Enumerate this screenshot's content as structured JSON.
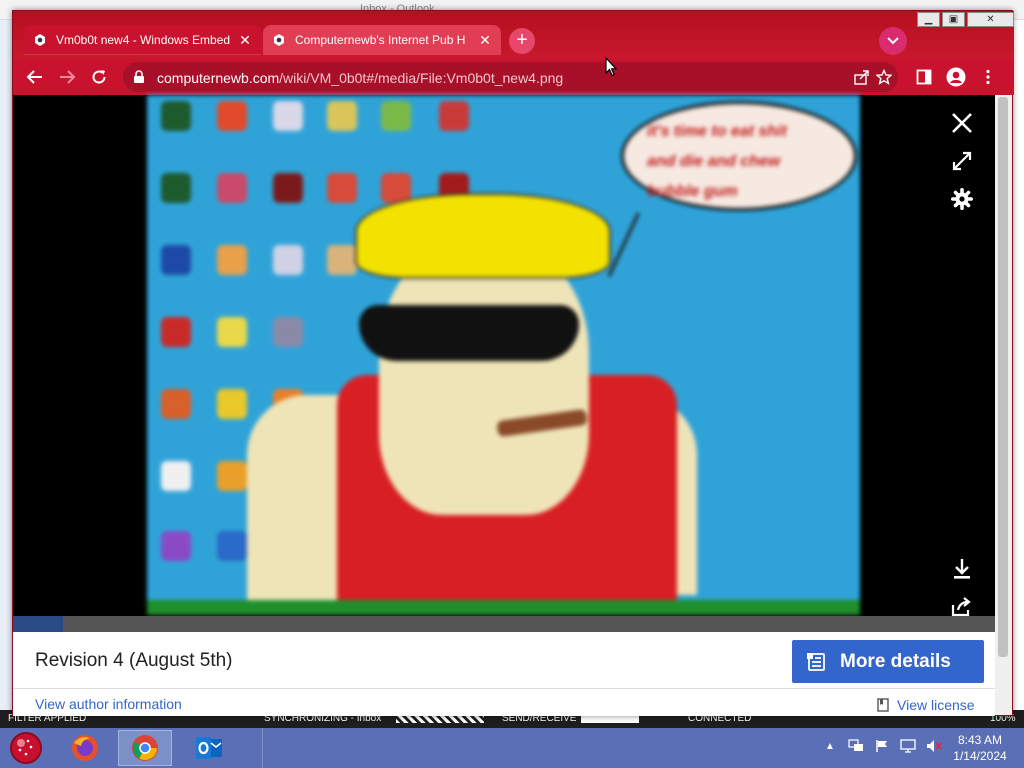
{
  "background_app": {
    "title": "Inbox - Outlook",
    "status": {
      "filter": "FILTER APPLIED",
      "sync": "SYNCHRONIZING - Inbox",
      "send_receive": "SEND/RECEIVE",
      "connection": "CONNECTED",
      "zoom": "100%"
    }
  },
  "browser": {
    "tabs": [
      {
        "title": "Vm0b0t new4 - Windows Embed",
        "active": true,
        "favicon": "wiki-favicon-icon"
      },
      {
        "title": "Computernewb's Internet Pub H",
        "active": false,
        "favicon": "wiki-favicon-icon"
      }
    ],
    "url": {
      "domain": "computernewb.com",
      "path": "/wiki/VM_0b0t#/media/File:Vm0b0t_new4.png"
    },
    "colors": {
      "frame": "#c7102e",
      "toolbar": "#c9132e",
      "omnibox": "#a8102a"
    }
  },
  "viewer": {
    "image_speech_text": [
      "it's time to eat shit",
      "and die and chew",
      "bubble gum"
    ],
    "revision": "Revision 4 (August 5th)",
    "more_details": "More details",
    "author_link": "View author information",
    "license_link": "View license"
  },
  "taskbar": {
    "apps": [
      "start-icon",
      "firefox-icon",
      "chrome-icon",
      "outlook-icon"
    ],
    "time": "8:43 AM",
    "date": "1/14/2024"
  }
}
